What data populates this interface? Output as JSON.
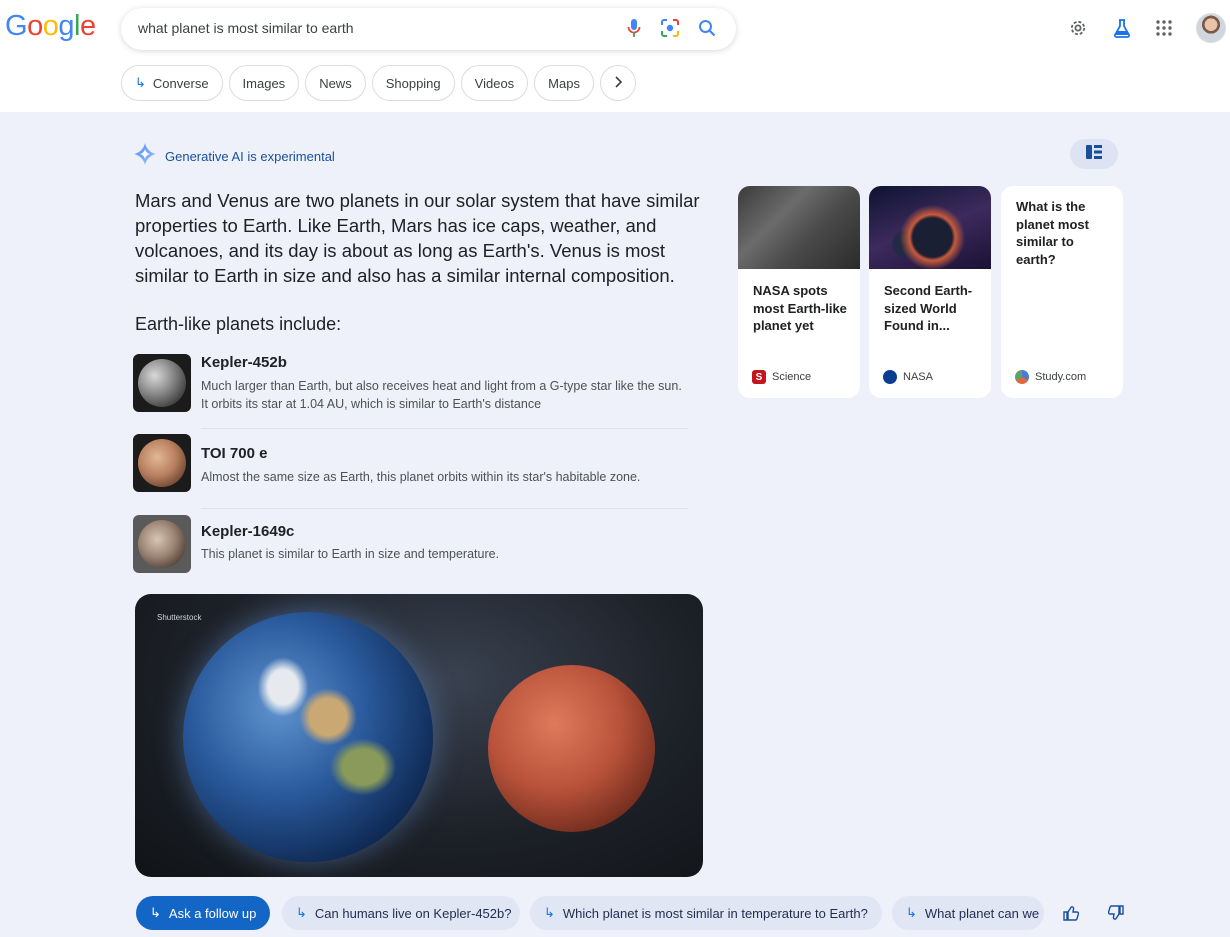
{
  "header": {
    "logo_letters": [
      "G",
      "o",
      "o",
      "g",
      "l",
      "e"
    ],
    "logo_colors": [
      "#4285F4",
      "#EA4335",
      "#FBBC05",
      "#4285F4",
      "#34A853",
      "#EA4335"
    ],
    "search_query": "what planet is most similar to earth",
    "icons": [
      "mic-icon",
      "lens-icon",
      "search-icon",
      "gear-icon",
      "labs-flask-icon",
      "apps-grid-icon",
      "avatar"
    ]
  },
  "chips": [
    {
      "label": "Converse",
      "icon": "converse-arrow-icon"
    },
    {
      "label": "Images"
    },
    {
      "label": "News"
    },
    {
      "label": "Shopping"
    },
    {
      "label": "Videos"
    },
    {
      "label": "Maps"
    }
  ],
  "ai": {
    "badge_label": "Generative AI is experimental",
    "summary": "Mars and Venus are two planets in our solar system that have similar properties to Earth. Like Earth, Mars has ice caps, weather, and volcanoes, and its day is about as long as Earth's. Venus is most similar to Earth in size and also has a similar internal composition.",
    "subhead": "Earth-like planets include:",
    "planets": [
      {
        "name": "Kepler-452b",
        "desc": "Much larger than Earth, but also receives heat and light from a G-type star like the sun. It orbits its star at 1.04 AU, which is similar to Earth's distance"
      },
      {
        "name": "TOI 700 e",
        "desc": "Almost the same size as Earth, this planet orbits within its star's habitable zone."
      },
      {
        "name": "Kepler-1649c",
        "desc": "This planet is similar to Earth in size and temperature."
      }
    ],
    "image_credit": "Shutterstock"
  },
  "cards": [
    {
      "title": "NASA spots most Earth-like planet yet",
      "source": "Science",
      "favicon_letter": "S",
      "favicon_color": "#c4151c"
    },
    {
      "title": "Second Earth-sized World Found in...",
      "source": "NASA",
      "favicon_letter": "",
      "favicon_color": "#0b3d91"
    },
    {
      "title": "What is the planet most similar to earth?",
      "source": "Study.com",
      "favicon_letter": "",
      "favicon_color": "#4a7bd0"
    }
  ],
  "footer": {
    "followup_label": "Ask a follow up",
    "suggestions": [
      "Can humans live on Kepler-452b?",
      "Which planet is most similar in temperature to Earth?",
      "What planet can we"
    ]
  },
  "colors": {
    "accent_blue": "#1466c6",
    "page_bg": "#eef1fa"
  }
}
